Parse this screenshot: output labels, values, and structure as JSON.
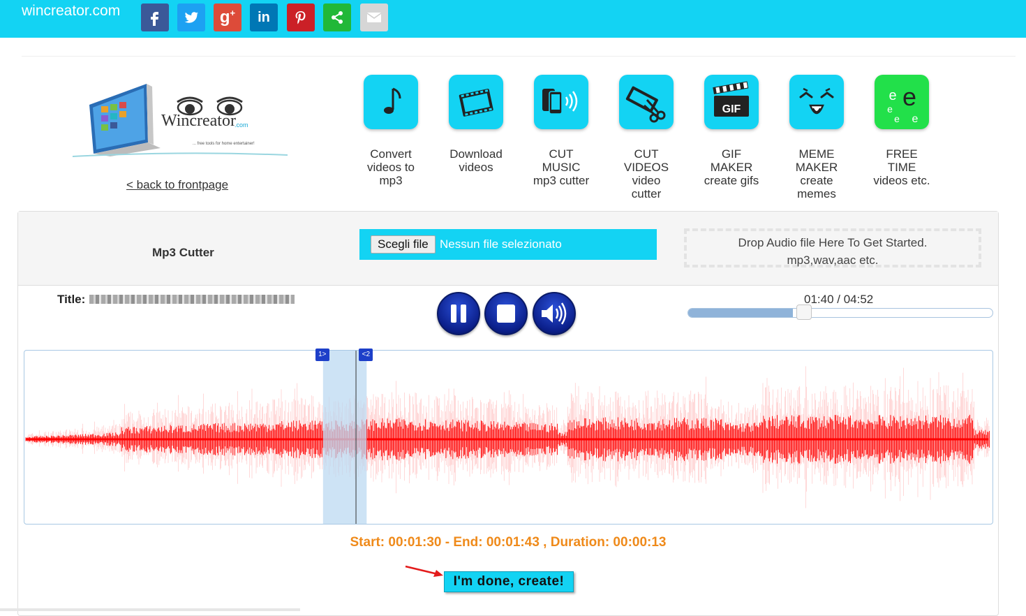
{
  "topbar": {
    "site_name": "wincreator.com",
    "share_buttons": [
      {
        "name": "facebook",
        "color": "#3b5998",
        "glyph": "f"
      },
      {
        "name": "twitter",
        "color": "#1da1f2",
        "glyph": "bird"
      },
      {
        "name": "google-plus",
        "color": "#dd4b39",
        "glyph": "g+"
      },
      {
        "name": "linkedin",
        "color": "#0077b5",
        "glyph": "in"
      },
      {
        "name": "pinterest",
        "color": "#cb2027",
        "glyph": "P"
      },
      {
        "name": "share",
        "color": "#21b838",
        "glyph": "share"
      },
      {
        "name": "email",
        "color": "#d6d6d6",
        "glyph": "mail"
      }
    ]
  },
  "logo": {
    "brand": "Wincreator",
    "suffix": ".com",
    "tagline": "... free tools for home entertainer!"
  },
  "nav": {
    "back_link": "< back to frontpage"
  },
  "tools": [
    {
      "id": "convert",
      "icon": "music-note-icon",
      "lines": [
        "Convert",
        "videos to",
        "mp3"
      ]
    },
    {
      "id": "download",
      "icon": "film-icon",
      "lines": [
        "Download",
        "videos"
      ]
    },
    {
      "id": "cut-music",
      "icon": "phone-sound-icon",
      "lines": [
        "CUT",
        "MUSIC",
        "mp3 cutter"
      ]
    },
    {
      "id": "cut-videos",
      "icon": "film-scissors-icon",
      "lines": [
        "CUT",
        "VIDEOS",
        "video",
        "cutter"
      ]
    },
    {
      "id": "gif-maker",
      "icon": "gif-clapper-icon",
      "lines": [
        "GIF",
        "MAKER",
        "create gifs"
      ]
    },
    {
      "id": "meme-maker",
      "icon": "meme-face-icon",
      "lines": [
        "MEME",
        "MAKER",
        "create",
        "memes"
      ]
    },
    {
      "id": "free-time",
      "icon": "letters-e-icon",
      "lines": [
        "FREE",
        "TIME",
        "videos etc."
      ]
    }
  ],
  "cutter": {
    "title": "Mp3 Cutter",
    "file_button": "Scegli file",
    "file_status": "Nessun file selezionato",
    "drop_line1": "Drop Audio file Here To Get Started.",
    "drop_line2": "mp3,wav,aac etc.",
    "track_label": "Title:",
    "time_readout": "01:40 / 04:52",
    "progress_fraction": 0.342,
    "selection_start_fraction": 0.308,
    "selection_end_fraction": 0.353,
    "marker_start": "1>",
    "marker_end": "<2",
    "timing": "Start: 00:01:30 - End: 00:01:43 , Duration: 00:00:13",
    "done_button": "I'm done, create!"
  },
  "colors": {
    "accent": "#13d3f3",
    "wave": "#ff0000",
    "timing_text": "#ef8a1a",
    "control_blue": "#0b1f8a",
    "selection": "#bcd9f2"
  }
}
